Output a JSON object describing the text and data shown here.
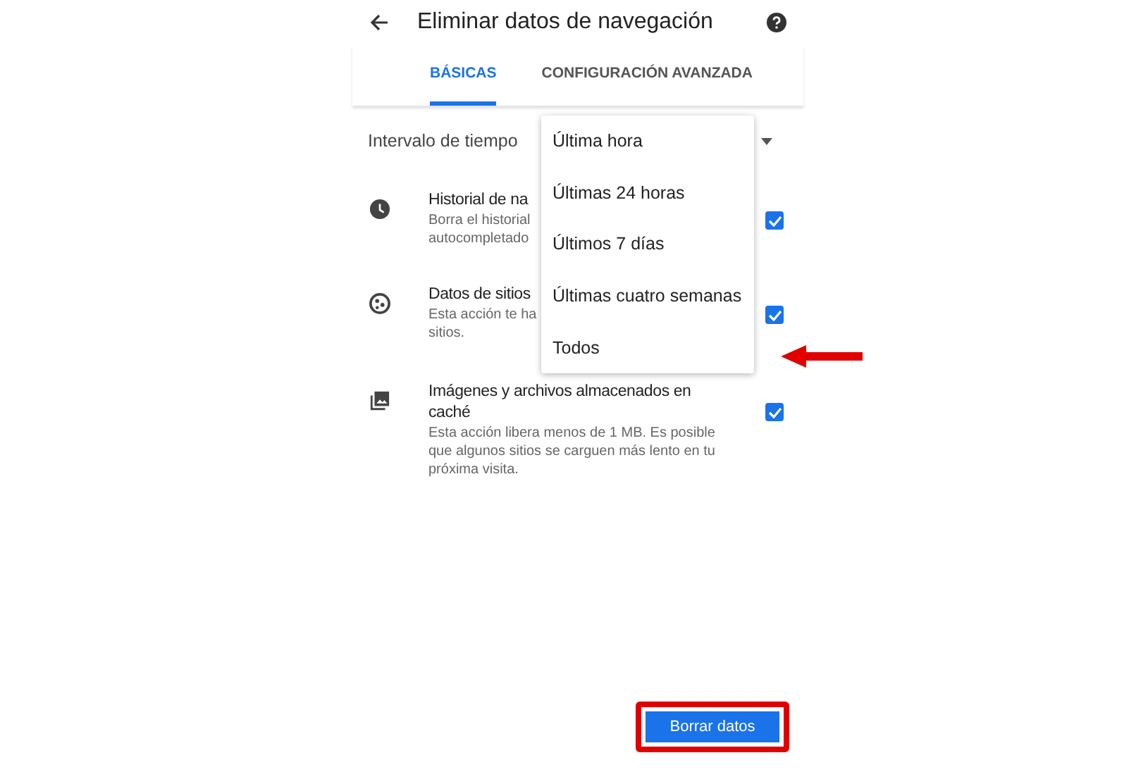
{
  "header": {
    "title": "Eliminar datos de navegación"
  },
  "tabs": [
    {
      "label": "BÁSICAS",
      "selected": true
    },
    {
      "label": "CONFIGURACIÓN AVANZADA",
      "selected": false
    }
  ],
  "time_range": {
    "label": "Intervalo de tiempo"
  },
  "time_range_menu": [
    "Última hora",
    "Últimas 24 horas",
    "Últimos 7 días",
    "Últimas cuatro semanas",
    "Todos"
  ],
  "items": [
    {
      "kind": "history",
      "title_lines": [
        "Historial de na"
      ],
      "description_lines": [
        "Borra el historial",
        "autocompletado"
      ],
      "checked": true
    },
    {
      "kind": "cookies",
      "title_lines": [
        "Datos de sitios"
      ],
      "description_lines": [
        "Esta acción te ha",
        "sitios."
      ],
      "checked": true
    },
    {
      "kind": "images",
      "title_lines": [
        "Imágenes y archivos almacenados en",
        "caché"
      ],
      "description_lines": [
        "Esta acción libera menos de 1 MB. Es posible",
        "que algunos sitios se carguen más lento en tu",
        "próxima visita."
      ],
      "checked": true
    }
  ],
  "button": {
    "label": "Borrar datos"
  }
}
